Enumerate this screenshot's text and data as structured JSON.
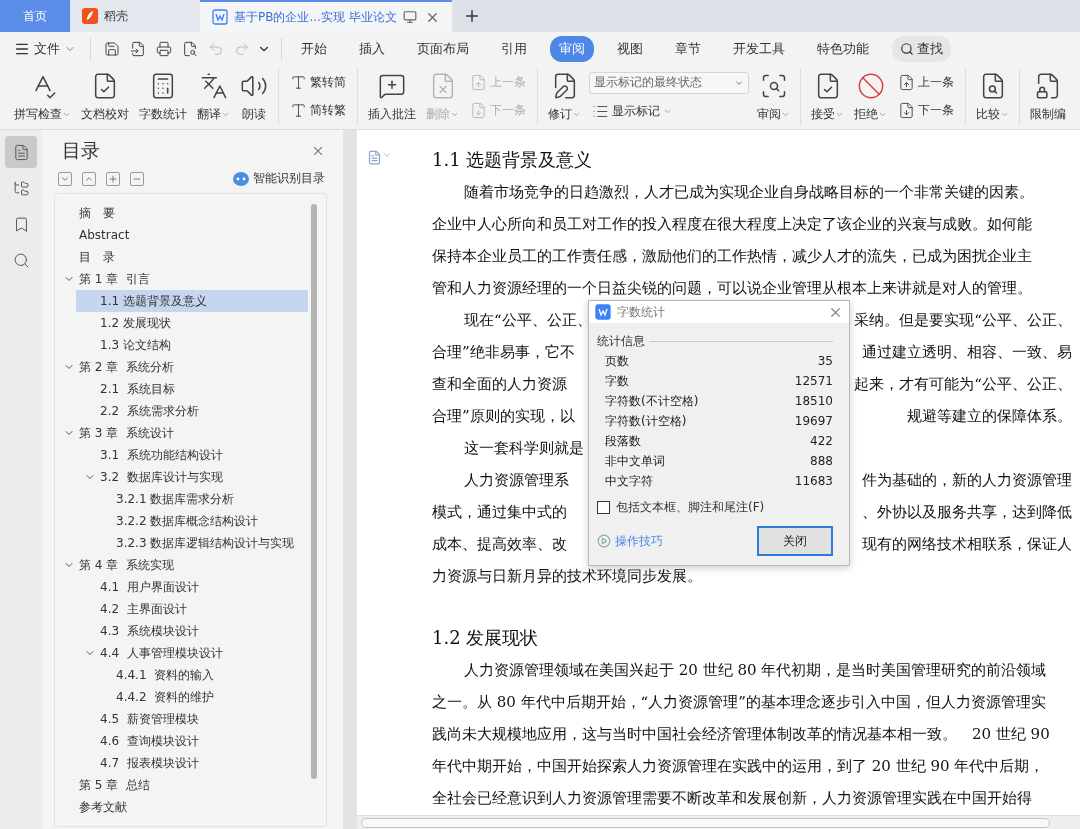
{
  "tabs": [
    {
      "label": "首页",
      "kind": "home",
      "selected": false
    },
    {
      "label": "稻壳",
      "kind": "docer",
      "selected": false
    },
    {
      "label": "基于PB的企业...实现 毕业论文",
      "kind": "doc",
      "selected": true
    }
  ],
  "menu": {
    "file": "文件",
    "quick_tools": [
      {
        "disabled": false
      },
      {
        "disabled": false
      },
      {
        "disabled": false
      },
      {
        "disabled": false
      },
      {
        "disabled": true
      },
      {
        "disabled": true
      }
    ],
    "tabs": [
      {
        "label": "开始",
        "selected": false
      },
      {
        "label": "插入",
        "selected": false
      },
      {
        "label": "页面布局",
        "selected": false
      },
      {
        "label": "引用",
        "selected": false
      },
      {
        "label": "审阅",
        "selected": true
      },
      {
        "label": "视图",
        "selected": false
      },
      {
        "label": "章节",
        "selected": false
      },
      {
        "label": "开发工具",
        "selected": false
      },
      {
        "label": "特色功能",
        "selected": false
      }
    ],
    "search": "查找"
  },
  "ribbon": [
    {
      "items": [
        {
          "kind": "big",
          "label": "拼写检查",
          "dropdown": true,
          "disabled": false
        },
        {
          "kind": "big",
          "label": "文档校对",
          "dropdown": false,
          "disabled": false
        },
        {
          "kind": "big",
          "label": "字数统计",
          "dropdown": false,
          "disabled": false
        },
        {
          "kind": "big",
          "label": "翻译",
          "dropdown": true,
          "disabled": false
        },
        {
          "kind": "big",
          "label": "朗读",
          "dropdown": false,
          "disabled": false
        }
      ]
    },
    {
      "items": [
        {
          "kind": "column",
          "items": [
            {
              "kind": "small",
              "label": "繁转简",
              "dropdown": false,
              "disabled": false
            },
            {
              "kind": "small",
              "label": "简转繁",
              "dropdown": false,
              "disabled": false
            }
          ]
        }
      ]
    },
    {
      "items": [
        {
          "kind": "big",
          "label": "插入批注",
          "dropdown": false,
          "disabled": false
        },
        {
          "kind": "big",
          "label": "删除",
          "dropdown": true,
          "disabled": true
        },
        {
          "kind": "column",
          "items": [
            {
              "kind": "small",
              "label": "上一条",
              "dropdown": false,
              "disabled": true
            },
            {
              "kind": "small",
              "label": "下一条",
              "dropdown": false,
              "disabled": true
            }
          ]
        }
      ]
    },
    {
      "items": [
        {
          "kind": "big",
          "label": "修订",
          "dropdown": true,
          "disabled": false
        },
        {
          "kind": "column",
          "items": [
            {
              "kind": "select",
              "value": "显示标记的最终状态"
            },
            {
              "kind": "small",
              "label": "显示标记",
              "dropdown": true,
              "disabled": false
            }
          ]
        },
        {
          "kind": "big",
          "label": "审阅",
          "dropdown": true,
          "disabled": false
        }
      ]
    },
    {
      "items": [
        {
          "kind": "big",
          "label": "接受",
          "dropdown": true,
          "disabled": false
        },
        {
          "kind": "big",
          "label": "拒绝",
          "dropdown": true,
          "disabled": false
        },
        {
          "kind": "column",
          "items": [
            {
              "kind": "small",
              "label": "上一条",
              "dropdown": false,
              "disabled": false
            },
            {
              "kind": "small",
              "label": "下一条",
              "dropdown": false,
              "disabled": false
            }
          ]
        }
      ]
    },
    {
      "items": [
        {
          "kind": "big",
          "label": "比较",
          "dropdown": true,
          "disabled": false
        }
      ]
    },
    {
      "items": [
        {
          "kind": "big",
          "label": "限制编",
          "dropdown": false,
          "disabled": false
        }
      ]
    }
  ],
  "rail": [
    {
      "kind": "toc",
      "selected": true
    },
    {
      "kind": "nav",
      "selected": false
    },
    {
      "kind": "bookmark",
      "selected": false
    },
    {
      "kind": "search",
      "selected": false
    }
  ],
  "toc": {
    "title": "目录",
    "smart": "智能识别目录",
    "items": [
      {
        "label": "摘　要"
      },
      {
        "label": "Abstract"
      },
      {
        "label": "目　录"
      },
      {
        "label": "第 1 章  引言",
        "expanded": true,
        "children": [
          {
            "label": "1.1 选题背景及意义",
            "selected": true
          },
          {
            "label": "1.2 发展现状",
            "selected": false
          },
          {
            "label": "1.3 论文结构",
            "selected": false
          }
        ]
      },
      {
        "label": "第 2 章  系统分析",
        "expanded": true,
        "children": [
          {
            "label": "2.1  系统目标",
            "selected": false
          },
          {
            "label": "2.2  系统需求分析",
            "selected": false
          }
        ]
      },
      {
        "label": "第 3 章  系统设计",
        "expanded": true,
        "children": [
          {
            "label": "3.1  系统功能结构设计",
            "selected": false
          },
          {
            "label": "3.2  数据库设计与实现",
            "selected": false,
            "expanded": true,
            "children": [
              {
                "label": "3.2.1 数据库需求分析",
                "selected": false
              },
              {
                "label": "3.2.2 数据库概念结构设计",
                "selected": false
              },
              {
                "label": "3.2.3 数据库逻辑结构设计与实现",
                "selected": false
              }
            ]
          }
        ]
      },
      {
        "label": "第 4 章  系统实现",
        "expanded": true,
        "children": [
          {
            "label": "4.1  用户界面设计",
            "selected": false
          },
          {
            "label": "4.2  主界面设计",
            "selected": false
          },
          {
            "label": "4.3  系统模块设计",
            "selected": false
          },
          {
            "label": "4.4  人事管理模块设计",
            "selected": false,
            "expanded": true,
            "children": [
              {
                "label": "4.4.1  资料的输入",
                "selected": false
              },
              {
                "label": "4.4.2  资料的维护",
                "selected": false
              }
            ]
          },
          {
            "label": "4.5  薪资管理模块",
            "selected": false
          },
          {
            "label": "4.6  查询模块设计",
            "selected": false
          },
          {
            "label": "4.7  报表模块设计",
            "selected": false
          }
        ]
      },
      {
        "label": "第 5 章  总结"
      },
      {
        "label": "参考文献"
      }
    ]
  },
  "document": {
    "sections": [
      {
        "heading": "1.1 选题背景及意义",
        "paragraphs": [
          {
            "lines": [
              [
                "随着市场竞争的日趋激烈，人才已成为实现企业自身战略目标的一个非常关键的因素。"
              ],
              [
                "企业中人心所向和员工对工作的投入程度在很大程度上决定了该企业的兴衰与成败。如何能"
              ],
              [
                "保持本企业员工的工作责任感，激励他们的工作热情，减少人才的流失，已成为困扰企业主"
              ],
              [
                "管和人力资源经理的一个日益尖锐的问题，可以说企业管理从根本上来讲就是对人的管理。"
              ]
            ]
          },
          {
            "lines": [
              [
                "现在“公平、公正、",
                "采纳。但是要实现“公平、公正、"
              ],
              [
                "合理”绝非易事，它不",
                "通过建立透明、相容、一致、易"
              ],
              [
                "查和全面的人力资源",
                "起来，才有可能为“公平、公正、"
              ],
              [
                "合理”原则的实现，以",
                "规避等建立的保障体系。"
              ]
            ]
          },
          {
            "lines": [
              [
                "这一套科学则就是"
              ]
            ]
          },
          {
            "lines": [
              [
                "人力资源管理系",
                "件为基础的，新的人力资源管理"
              ],
              [
                "模式，通过集中式的",
                "、外协以及服务共享，达到降低"
              ],
              [
                "成本、提高效率、改",
                "现有的网络技术相联系，保证人"
              ],
              [
                "力资源与日新月异的技术环境同步发展。"
              ]
            ]
          }
        ]
      },
      {
        "heading": "1.2 发展现状",
        "paragraphs": [
          {
            "lines": [
              [
                "人力资源管理领域在美国兴起于 20 世纪 80 年代初期，是当时美国管理研究的前沿领域"
              ],
              [
                "之一。从 80 年代中后期开始，“人力资源管理”的基本理念逐步引入中国，但人力资源管理实"
              ],
              [
                "践尚未大规模地应用，这与当时中国社会经济管理体制改革的情况基本相一致。　20 世纪 90"
              ],
              [
                "年代中期开始，中国开始探索人力资源管理在实践中的运用，到了 20 世纪 90 年代中后期，"
              ],
              [
                "全社会已经意识到人力资源管理需要不断改革和发展创新，人力资源管理实践在中国开始得"
              ]
            ]
          }
        ]
      }
    ]
  },
  "dialog": {
    "title": "字数统计",
    "section": "统计信息",
    "rows": [
      {
        "label": "页数",
        "value": "35"
      },
      {
        "label": "字数",
        "value": "12571"
      },
      {
        "label": "字符数(不计空格)",
        "value": "18510"
      },
      {
        "label": "字符数(计空格)",
        "value": "19697"
      },
      {
        "label": "段落数",
        "value": "422"
      },
      {
        "label": "非中文单词",
        "value": "888"
      },
      {
        "label": "中文字符",
        "value": "11683"
      }
    ],
    "checkbox": {
      "label": "包括文本框、脚注和尾注(F)",
      "checked": false
    },
    "tips": "操作技巧",
    "button": "关闭"
  }
}
